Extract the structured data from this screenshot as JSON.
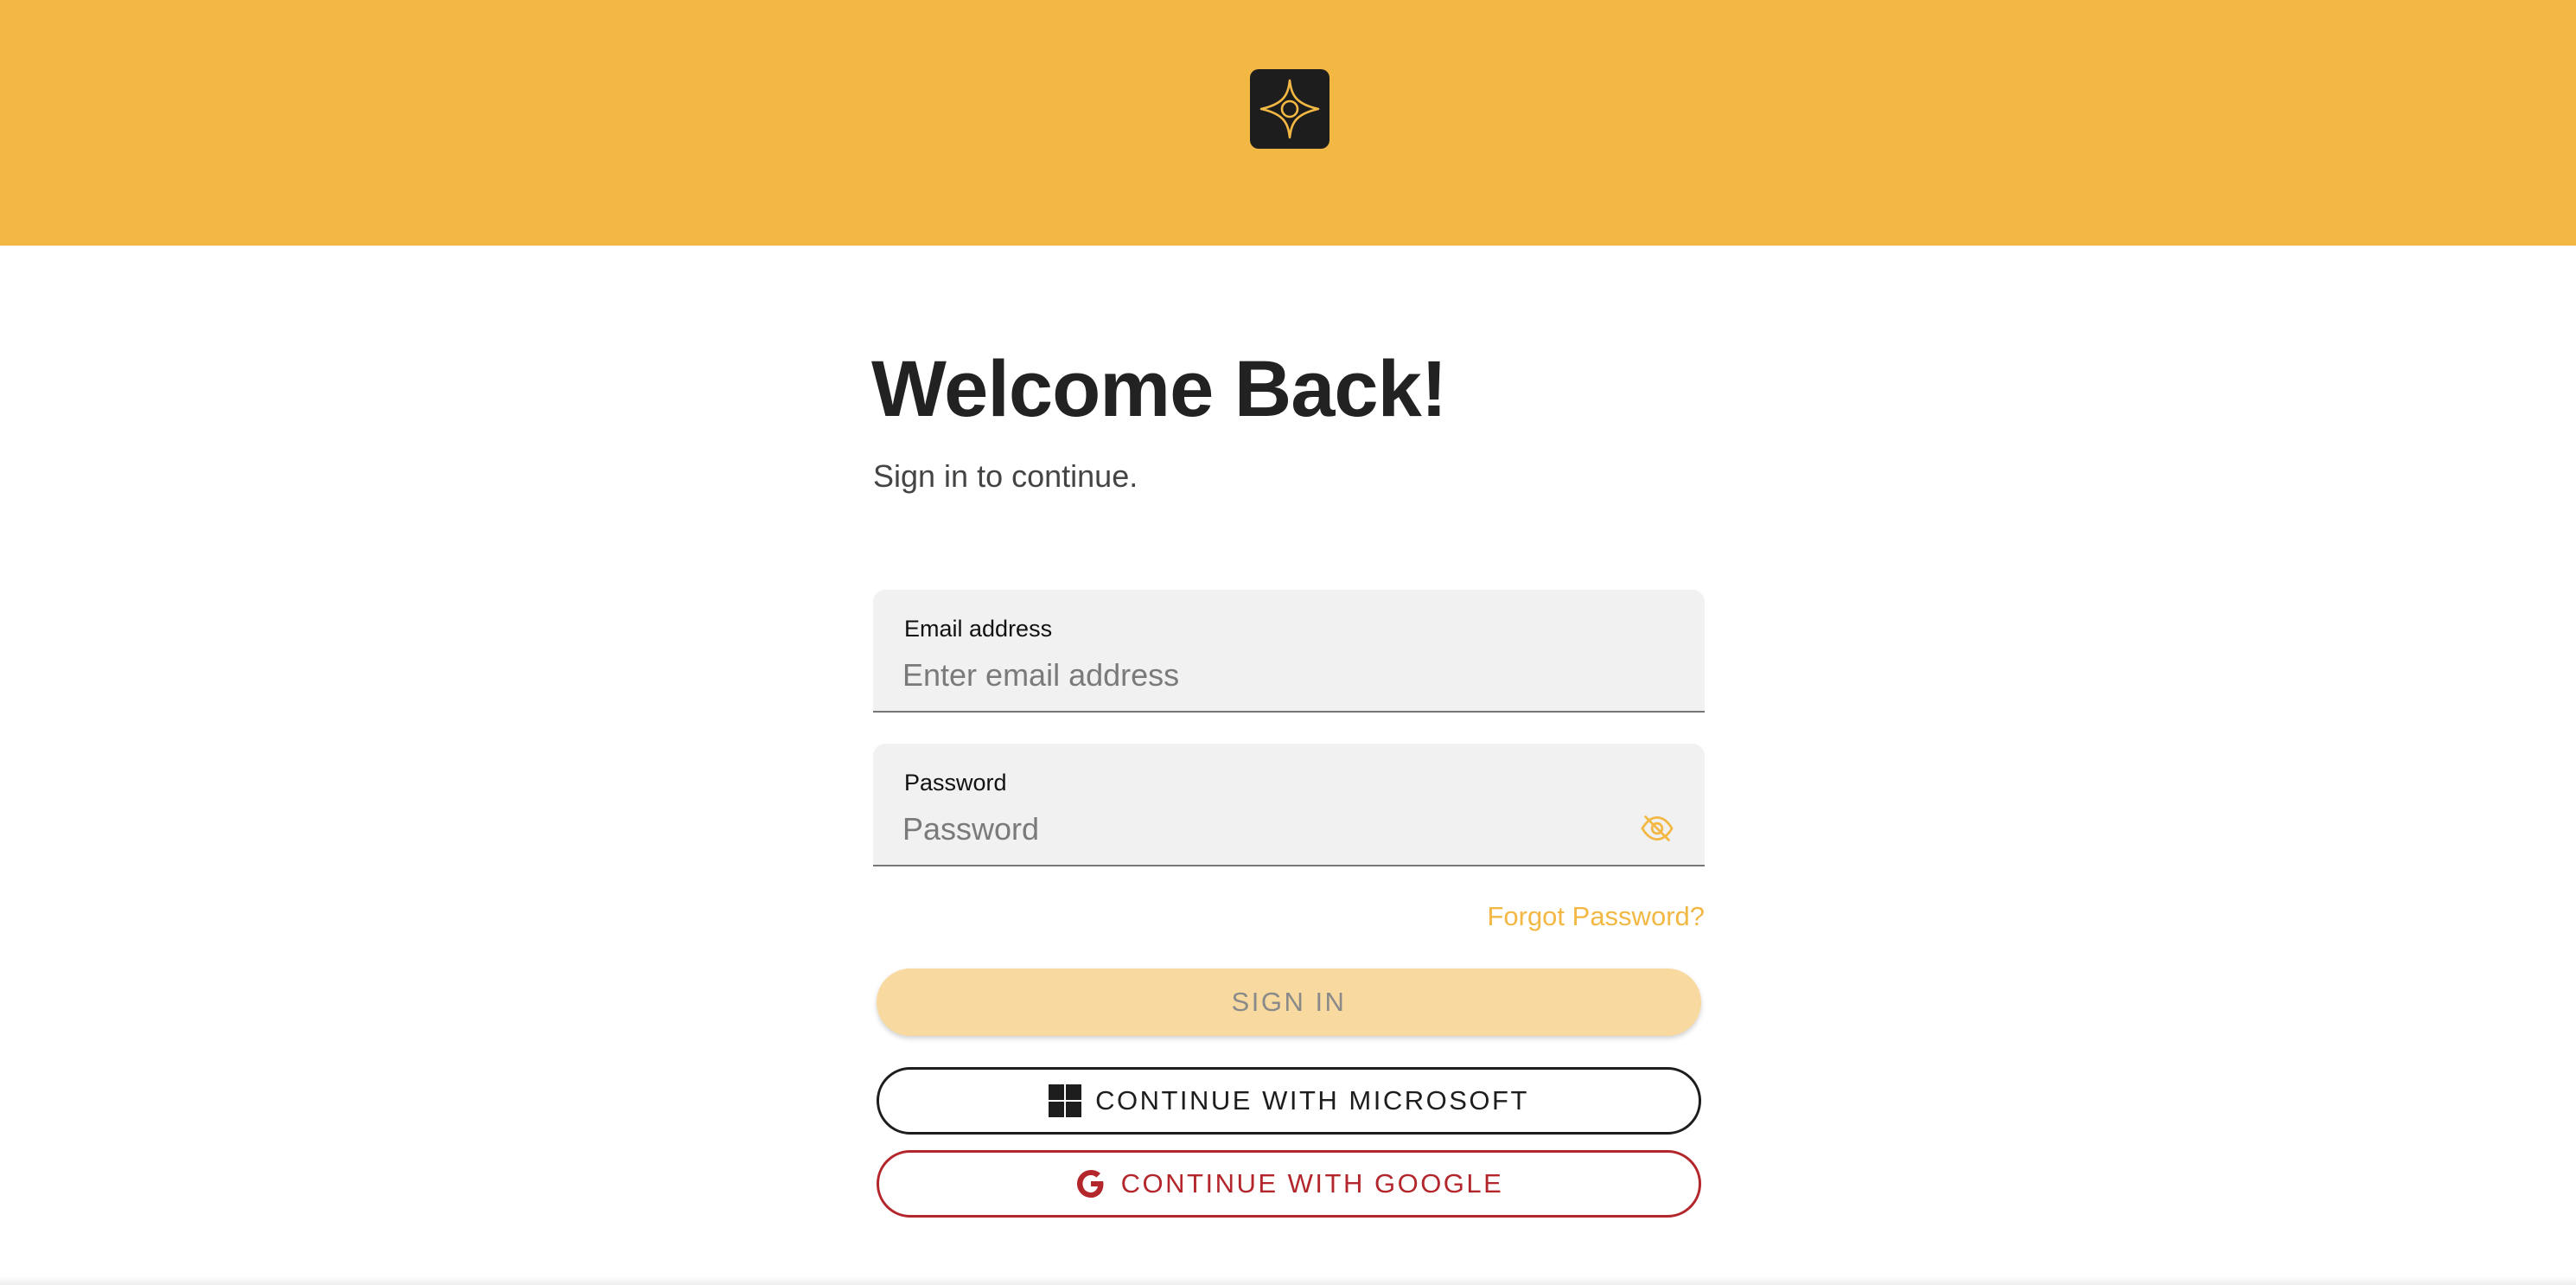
{
  "brand": {
    "header_color": "#F2B843",
    "logo_tile_color": "#1d1d1d",
    "logo_icon": "compass-star-icon"
  },
  "main": {
    "title": "Welcome Back!",
    "subtitle": "Sign in to continue."
  },
  "form": {
    "email": {
      "label": "Email address",
      "placeholder": "Enter email address",
      "value": ""
    },
    "password": {
      "label": "Password",
      "placeholder": "Password",
      "value": "",
      "toggle_icon": "eye-off-icon"
    },
    "forgot_password": "Forgot Password?"
  },
  "buttons": {
    "sign_in": "SIGN IN",
    "microsoft": "CONTINUE WITH MICROSOFT",
    "google": "CONTINUE WITH GOOGLE"
  },
  "colors": {
    "accent": "#F2B843",
    "signin_disabled_bg": "#F8DAA0",
    "google_red": "#B3262B",
    "dark": "#1d1d1d"
  }
}
